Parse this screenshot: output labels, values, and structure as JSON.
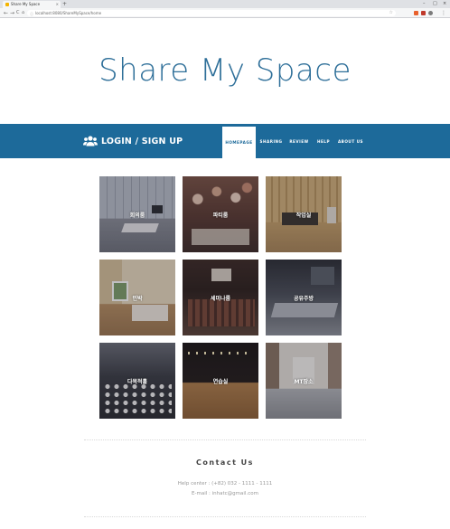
{
  "browser": {
    "tab_title": "Share My Space",
    "tab_close": "×",
    "new_tab": "+",
    "window_controls": [
      "–",
      "□",
      "×"
    ],
    "nav": [
      "←",
      "→",
      "C",
      "⌂"
    ],
    "url": "localhost:8080/ShareMySpace/home"
  },
  "site": {
    "title": "Share My Space"
  },
  "navbar": {
    "login_label": "LOGIN / SIGN UP",
    "menu": [
      "HOMEPAGE",
      "SHARING",
      "REVIEW",
      "HELP",
      "ABOUT US"
    ],
    "active_index": 0
  },
  "spaces": [
    {
      "label": "회의룸"
    },
    {
      "label": "파티룸"
    },
    {
      "label": "작업실"
    },
    {
      "label": "민박"
    },
    {
      "label": "세미나룸"
    },
    {
      "label": "공유주방"
    },
    {
      "label": "다목적홀"
    },
    {
      "label": "연습실"
    },
    {
      "label": "MT장소"
    }
  ],
  "contact": {
    "title": "Contact Us",
    "help_center": "Help center : (+82) 032 - 1111 - 1111",
    "email": "E-mail : inhatc@gmail.com"
  }
}
